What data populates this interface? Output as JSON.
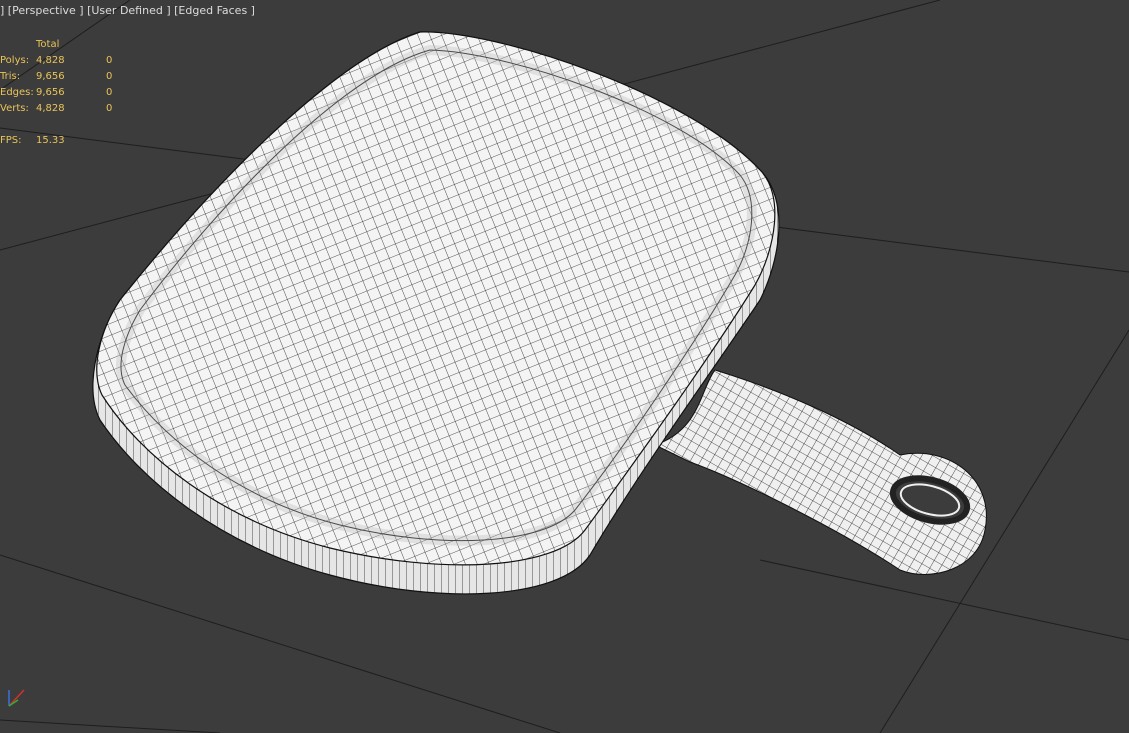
{
  "viewport": {
    "label_parts": [
      "]",
      "[Perspective",
      "]",
      "[User Defined",
      "]",
      "[Edged Faces",
      "]"
    ],
    "label_main": "[Perspective ] [User Defined ] [Edged Faces ]",
    "label_prefix": "]"
  },
  "stats": {
    "header": "Total",
    "rows": [
      {
        "label": "Polys:",
        "total": "4,828",
        "selected": "0"
      },
      {
        "label": "Tris:",
        "total": "9,656",
        "selected": "0"
      },
      {
        "label": "Edges:",
        "total": "9,656",
        "selected": "0"
      },
      {
        "label": "Verts:",
        "total": "4,828",
        "selected": "0"
      }
    ],
    "fps_label": "FPS:",
    "fps_value": "15.33"
  },
  "colors": {
    "background": "#3c3c3c",
    "grid": "#1e1e1e",
    "mesh_fill": "#f4f4f4",
    "mesh_wire": "#222222",
    "stats_text": "#e8c45a",
    "label_text": "#dcdcdc"
  },
  "icons": {
    "axis_gizmo": "axis-tripod-icon"
  }
}
